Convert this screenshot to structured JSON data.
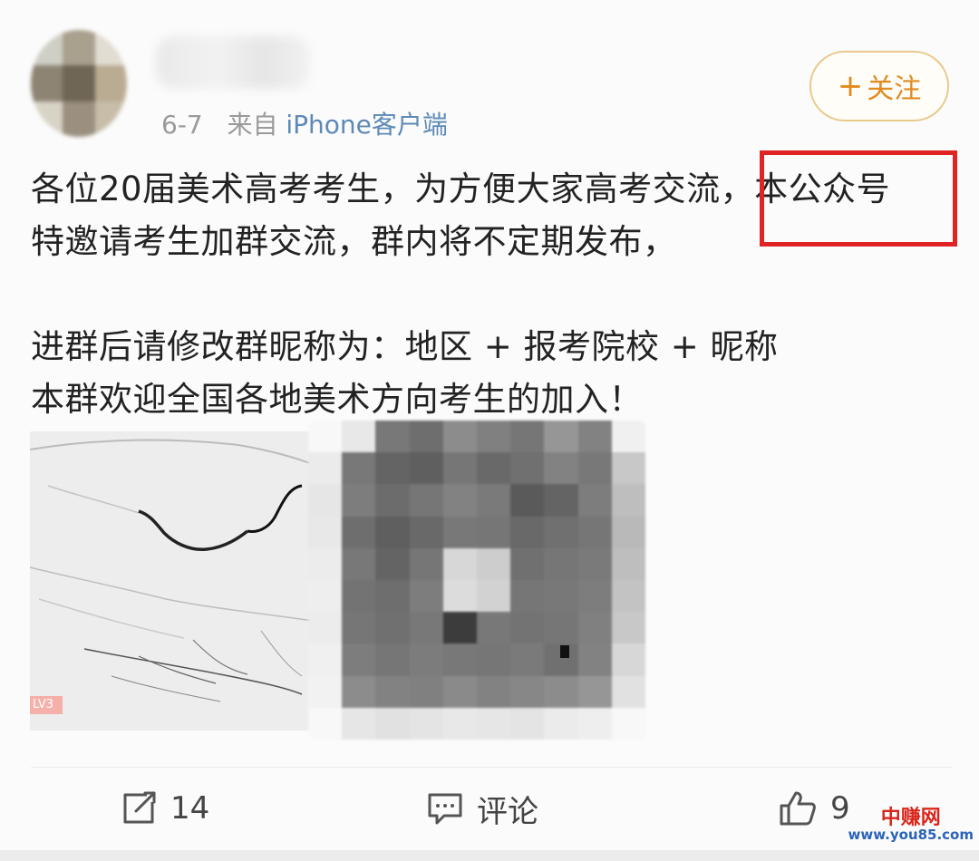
{
  "post": {
    "date": "6-7",
    "source_prefix": "来自",
    "source": "iPhone客户端",
    "follow_label": "关注",
    "follow_plus": "+",
    "text_lines": [
      "各位20届美术高考考生，为方便大家高考交流，本公众号",
      "特邀请考生加群交流，群内将不定期发布，",
      "",
      "进群后请修改群昵称为：地区 + 报考院校 + 昵称",
      "本群欢迎全国各地美术方向考生的加入！"
    ],
    "image_badge": "LV3"
  },
  "actions": {
    "repost_count": "14",
    "comment_label": "评论",
    "like_count": "9"
  },
  "watermark": {
    "top": "中赚网",
    "bottom": "www.you85.com"
  },
  "colors": {
    "accent_orange": "#e08a1f",
    "link_blue": "#5d8ab6",
    "highlight_red": "#e02424"
  },
  "icons": [
    "repost-icon",
    "comment-icon",
    "like-icon"
  ]
}
